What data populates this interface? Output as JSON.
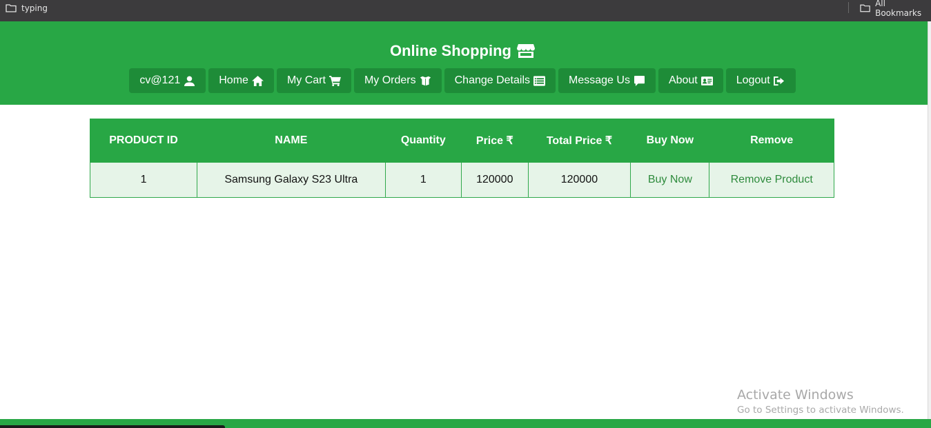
{
  "bookmarks_bar": {
    "left_folder": "typing",
    "right_folder": "All Bookmarks"
  },
  "header": {
    "title": "Online Shopping",
    "title_icon": "store-icon"
  },
  "nav": [
    {
      "label": "cv@121",
      "icon": "user-icon"
    },
    {
      "label": "Home",
      "icon": "home-icon"
    },
    {
      "label": "My Cart",
      "icon": "cart-icon"
    },
    {
      "label": "My Orders",
      "icon": "box-icon"
    },
    {
      "label": "Change Details",
      "icon": "list-icon"
    },
    {
      "label": "Message Us",
      "icon": "comment-icon"
    },
    {
      "label": "About",
      "icon": "id-card-icon"
    },
    {
      "label": "Logout",
      "icon": "sign-out-icon"
    }
  ],
  "table": {
    "columns": [
      "PRODUCT ID",
      "NAME",
      "Quantity",
      "Price ₹",
      "Total Price ₹",
      "Buy Now",
      "Remove"
    ],
    "rows": [
      {
        "product_id": "1",
        "name": "Samsung Galaxy S23 Ultra",
        "quantity": "1",
        "price": "120000",
        "total_price": "120000",
        "buy_label": "Buy Now",
        "remove_label": "Remove Product"
      }
    ]
  },
  "watermark": {
    "line1": "Activate Windows",
    "line2": "Go to Settings to activate Windows."
  },
  "colors": {
    "primary": "#28a745",
    "button": "#1e8c38",
    "row_bg": "#e6f4e8"
  }
}
